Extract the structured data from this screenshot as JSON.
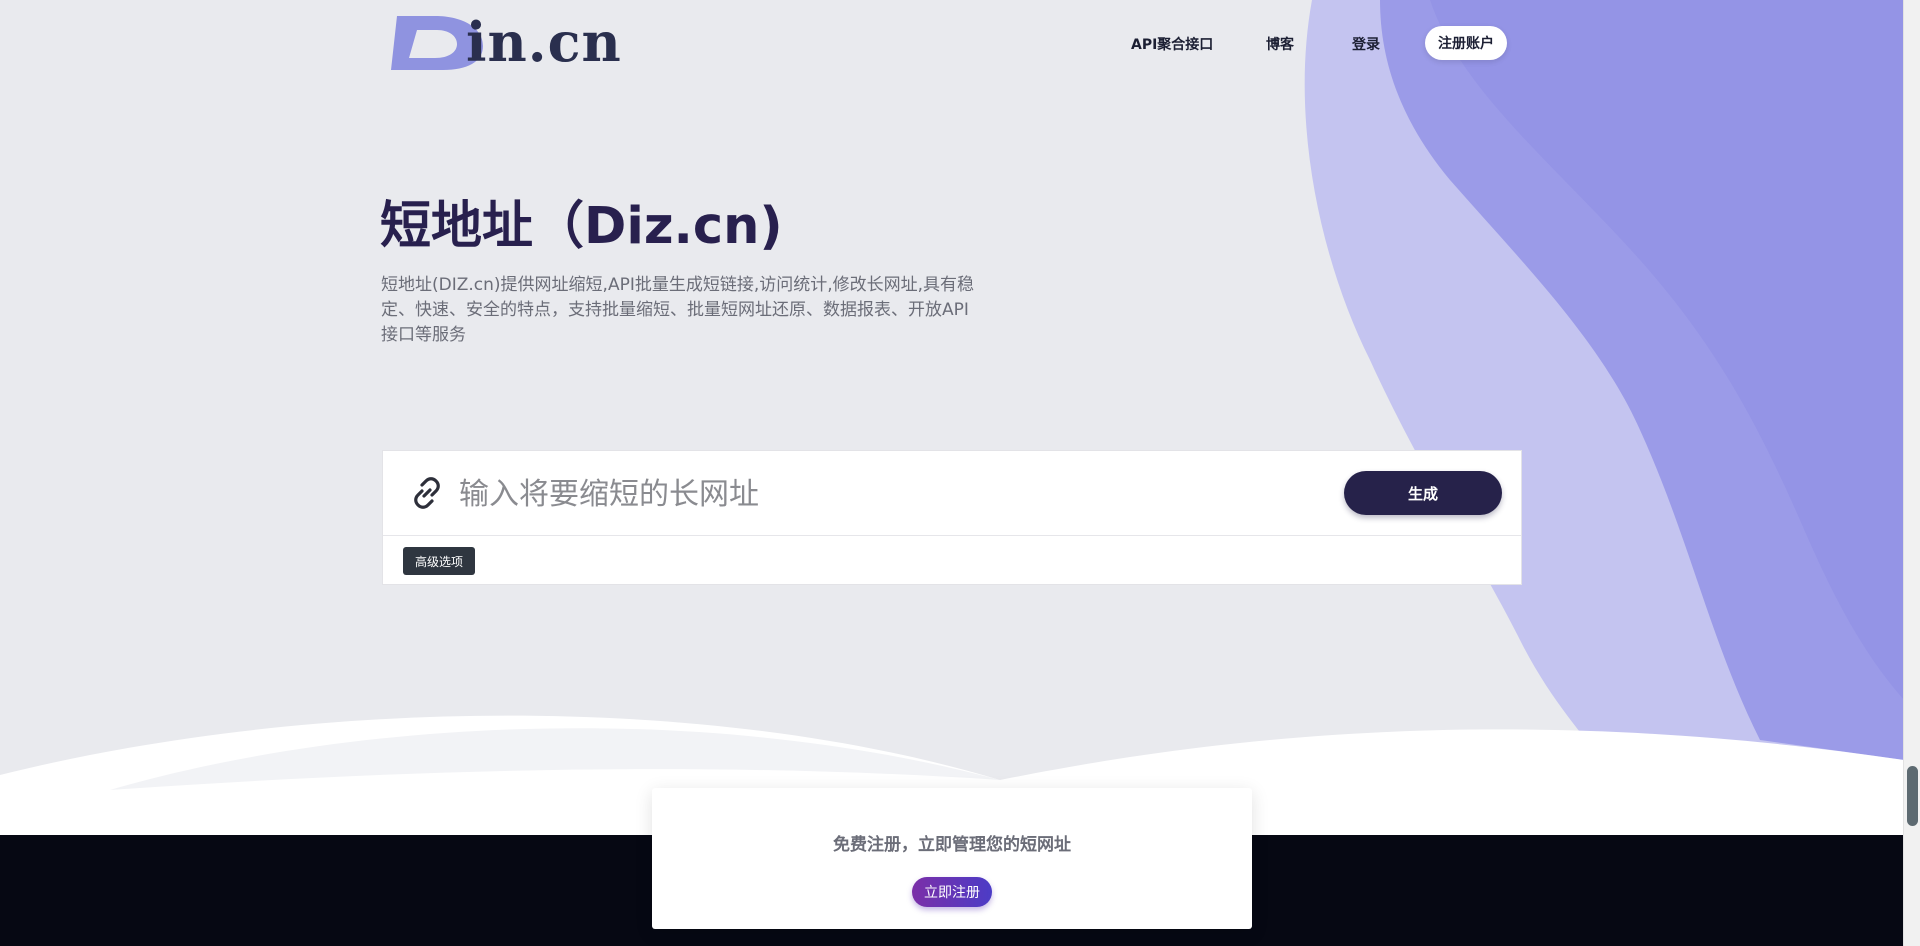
{
  "header": {
    "logo_text": "in.cn",
    "logo_glyph": "D",
    "nav": {
      "api": "API聚合接口",
      "blog": "博客",
      "login": "登录",
      "register": "注册账户"
    }
  },
  "hero": {
    "title_cn": "短地址",
    "title_en": "（Diz.cn)",
    "description": "短地址(DIZ.cn)提供网址缩短,API批量生成短链接,访问统计,修改长网址,具有稳定、快速、安全的特点，支持批量缩短、批量短网址还原、数据报表、开放API接口等服务"
  },
  "shortener": {
    "placeholder": "输入将要缩短的长网址",
    "generate_label": "生成",
    "advanced_label": "高级选项",
    "icon": "link-icon"
  },
  "register_card": {
    "text": "免费注册，立即管理您的短网址",
    "button_label": "立即注册"
  },
  "colors": {
    "accent_dark": "#26224a",
    "purple_shape": "#9797e8",
    "purple_light": "#c3c3f0",
    "footer": "#060813"
  }
}
